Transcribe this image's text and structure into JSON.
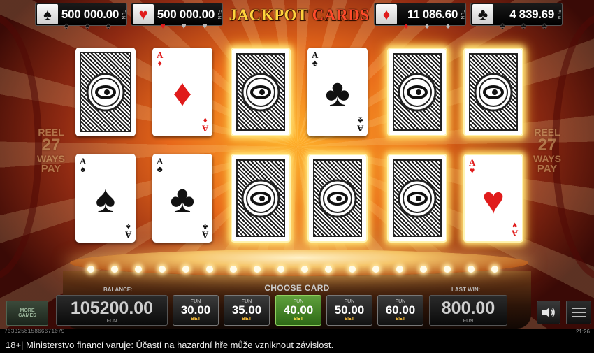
{
  "jackpots": [
    {
      "suit": "spade",
      "symbol": "♠",
      "value": "500 000.00",
      "fun": "FUN",
      "color": "#111111",
      "subsuits": [
        "♠",
        "♠",
        "♠"
      ]
    },
    {
      "suit": "heart",
      "symbol": "♥",
      "value": "500 000.00",
      "fun": "FUN",
      "color": "#e01b1b",
      "subsuits": [
        "♥",
        "♥",
        "♥"
      ]
    },
    {
      "suit": "diamond",
      "symbol": "♦",
      "value": "11 086.60",
      "fun": "FUN",
      "color": "#e01b1b",
      "subsuits": [
        "♦",
        "♦",
        "♦"
      ]
    },
    {
      "suit": "club",
      "symbol": "♣",
      "value": "4 839.69",
      "fun": "FUN",
      "color": "#111111",
      "subsuits": [
        "♣",
        "♣",
        "♣"
      ]
    }
  ],
  "logo": {
    "word1": "JACKPOT",
    "word2": "CARDS"
  },
  "reel_label": {
    "line1": "REEL",
    "line2": "27",
    "line3": "WAYS",
    "line4": "PAY"
  },
  "cards": [
    {
      "face": "back",
      "rank": "",
      "suit": "",
      "color": "",
      "glow": false
    },
    {
      "face": "up",
      "rank": "A",
      "suit": "♦",
      "color": "red",
      "glow": false
    },
    {
      "face": "back",
      "rank": "",
      "suit": "",
      "color": "",
      "glow": true
    },
    {
      "face": "up",
      "rank": "A",
      "suit": "♣",
      "color": "blk",
      "glow": false
    },
    {
      "face": "back",
      "rank": "",
      "suit": "",
      "color": "",
      "glow": true
    },
    {
      "face": "back",
      "rank": "",
      "suit": "",
      "color": "",
      "glow": true
    },
    {
      "face": "up",
      "rank": "A",
      "suit": "♠",
      "color": "blk",
      "glow": false
    },
    {
      "face": "up",
      "rank": "A",
      "suit": "♣",
      "color": "blk",
      "glow": false
    },
    {
      "face": "back",
      "rank": "",
      "suit": "",
      "color": "",
      "glow": true
    },
    {
      "face": "back",
      "rank": "",
      "suit": "",
      "color": "",
      "glow": true
    },
    {
      "face": "back",
      "rank": "",
      "suit": "",
      "color": "",
      "glow": true
    },
    {
      "face": "up",
      "rank": "A",
      "suit": "♥",
      "color": "red",
      "glow": true
    }
  ],
  "controls": {
    "choose_card": "CHOOSE CARD",
    "balance_label": "BALANCE:",
    "balance_value": "105200.00",
    "balance_fun": "FUN",
    "last_win_label": "LAST WIN:",
    "last_win_value": "800.00",
    "last_win_fun": "FUN",
    "bets": [
      {
        "fun": "FUN",
        "amount": "30.00",
        "bet": "BET",
        "active": false
      },
      {
        "fun": "FUN",
        "amount": "35.00",
        "bet": "BET",
        "active": false
      },
      {
        "fun": "FUN",
        "amount": "40.00",
        "bet": "BET",
        "active": true
      },
      {
        "fun": "FUN",
        "amount": "50.00",
        "bet": "BET",
        "active": false
      },
      {
        "fun": "FUN",
        "amount": "60.00",
        "bet": "BET",
        "active": false
      }
    ],
    "more_games": [
      "MORE",
      "GAMES"
    ]
  },
  "status": {
    "session_id": "703325815866671079",
    "time": "21:26"
  },
  "disclaimer": "18+| Ministerstvo financí varuje: Účastí na hazardní hře může vzniknout závislost."
}
